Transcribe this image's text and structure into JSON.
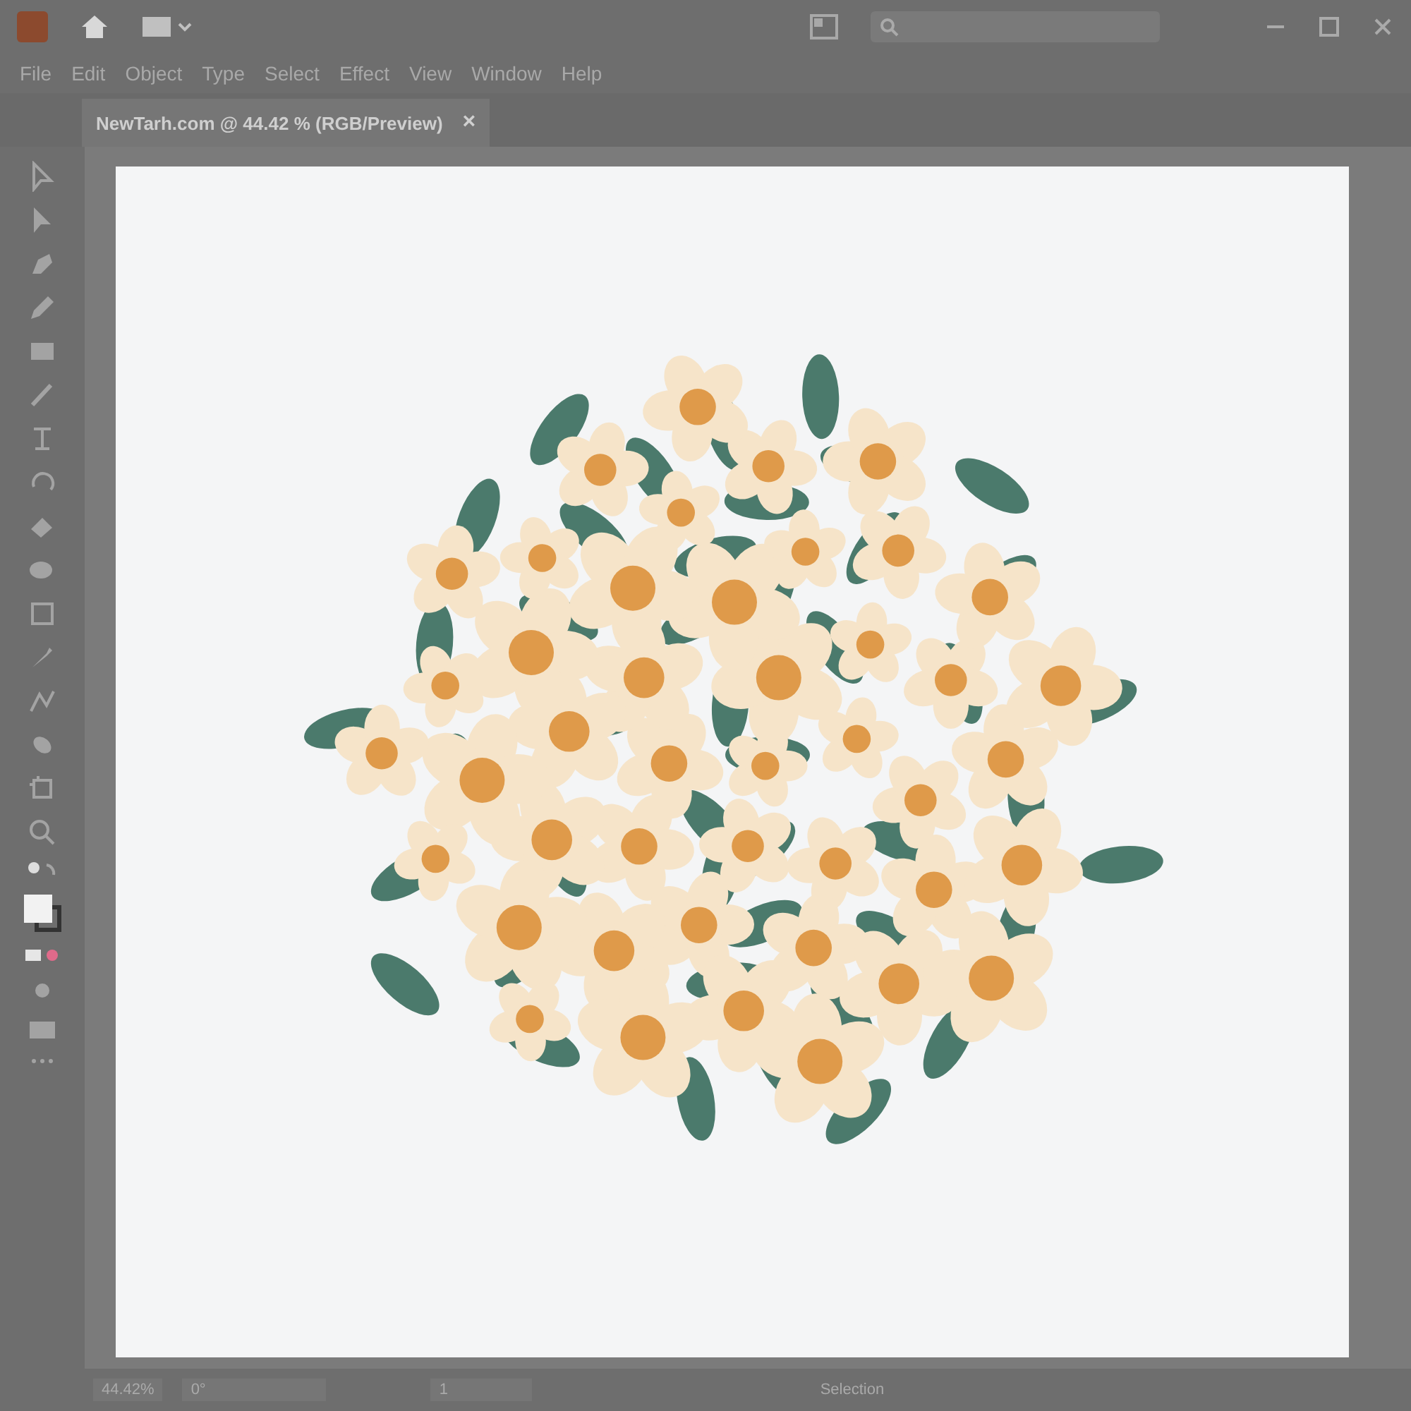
{
  "menu": [
    "File",
    "Edit",
    "Object",
    "Type",
    "Select",
    "Effect",
    "View",
    "Window",
    "Help"
  ],
  "document_tab": {
    "title": "NewTarh.com @ 44.42 % (RGB/Preview)",
    "close": "×"
  },
  "status_bar": {
    "zoom": "44.42%",
    "rotation": "0°",
    "artboard": "1",
    "tool": "Selection"
  }
}
